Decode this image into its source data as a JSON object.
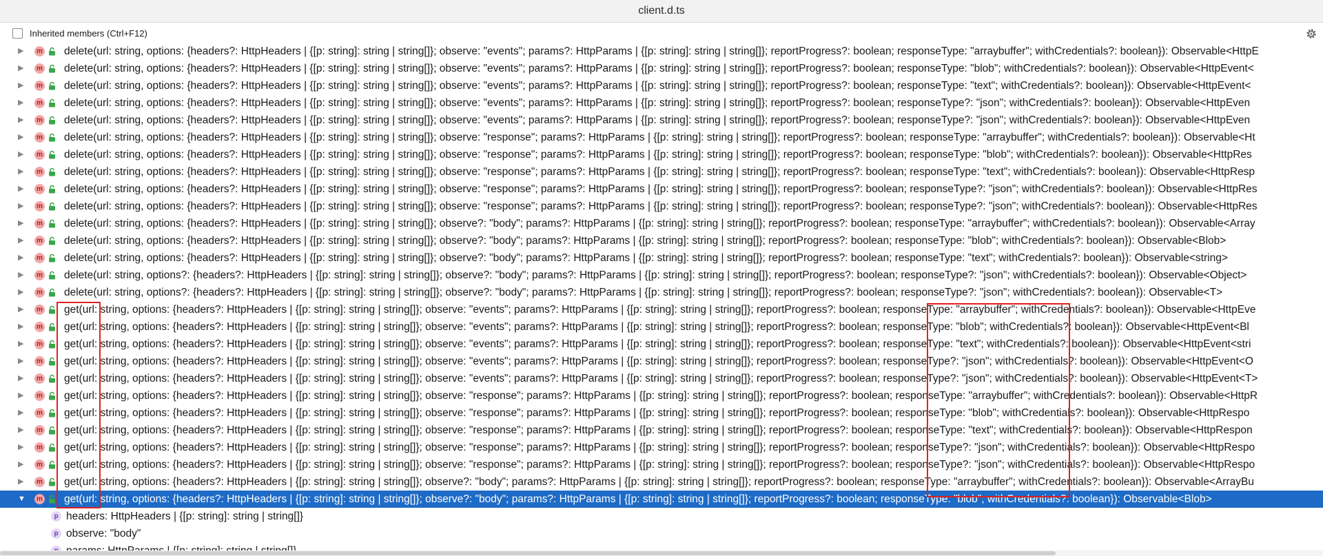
{
  "window": {
    "title": "client.d.ts"
  },
  "toolbar": {
    "inherited_label": "Inherited members (Ctrl+F12)",
    "inherited_checked": false,
    "settings_icon": "gear-icon"
  },
  "colors": {
    "selection": "#1e6bc7",
    "method_icon": "#f2a6a6",
    "property_icon": "#e4d7f5",
    "highlight_box": "#e02020"
  },
  "members": [
    {
      "kind": "m",
      "text": "delete(url: string, options: {headers?: HttpHeaders | {[p: string]: string | string[]}; observe: \"events\"; params?: HttpParams | {[p: string]: string | string[]}; reportProgress?: boolean; responseType: \"arraybuffer\"; withCredentials?: boolean}): Observable<HttpE"
    },
    {
      "kind": "m",
      "text": "delete(url: string, options: {headers?: HttpHeaders | {[p: string]: string | string[]}; observe: \"events\"; params?: HttpParams | {[p: string]: string | string[]}; reportProgress?: boolean; responseType: \"blob\"; withCredentials?: boolean}): Observable<HttpEvent<"
    },
    {
      "kind": "m",
      "text": "delete(url: string, options: {headers?: HttpHeaders | {[p: string]: string | string[]}; observe: \"events\"; params?: HttpParams | {[p: string]: string | string[]}; reportProgress?: boolean; responseType: \"text\"; withCredentials?: boolean}): Observable<HttpEvent<"
    },
    {
      "kind": "m",
      "text": "delete(url: string, options: {headers?: HttpHeaders | {[p: string]: string | string[]}; observe: \"events\"; params?: HttpParams | {[p: string]: string | string[]}; reportProgress?: boolean; responseType?: \"json\"; withCredentials?: boolean}): Observable<HttpEven"
    },
    {
      "kind": "m",
      "text": "delete(url: string, options: {headers?: HttpHeaders | {[p: string]: string | string[]}; observe: \"events\"; params?: HttpParams | {[p: string]: string | string[]}; reportProgress?: boolean; responseType?: \"json\"; withCredentials?: boolean}): Observable<HttpEven"
    },
    {
      "kind": "m",
      "text": "delete(url: string, options: {headers?: HttpHeaders | {[p: string]: string | string[]}; observe: \"response\"; params?: HttpParams | {[p: string]: string | string[]}; reportProgress?: boolean; responseType: \"arraybuffer\"; withCredentials?: boolean}): Observable<Ht"
    },
    {
      "kind": "m",
      "text": "delete(url: string, options: {headers?: HttpHeaders | {[p: string]: string | string[]}; observe: \"response\"; params?: HttpParams | {[p: string]: string | string[]}; reportProgress?: boolean; responseType: \"blob\"; withCredentials?: boolean}): Observable<HttpRes"
    },
    {
      "kind": "m",
      "text": "delete(url: string, options: {headers?: HttpHeaders | {[p: string]: string | string[]}; observe: \"response\"; params?: HttpParams | {[p: string]: string | string[]}; reportProgress?: boolean; responseType: \"text\"; withCredentials?: boolean}): Observable<HttpResp"
    },
    {
      "kind": "m",
      "text": "delete(url: string, options: {headers?: HttpHeaders | {[p: string]: string | string[]}; observe: \"response\"; params?: HttpParams | {[p: string]: string | string[]}; reportProgress?: boolean; responseType?: \"json\"; withCredentials?: boolean}): Observable<HttpRes"
    },
    {
      "kind": "m",
      "text": "delete(url: string, options: {headers?: HttpHeaders | {[p: string]: string | string[]}; observe: \"response\"; params?: HttpParams | {[p: string]: string | string[]}; reportProgress?: boolean; responseType?: \"json\"; withCredentials?: boolean}): Observable<HttpRes"
    },
    {
      "kind": "m",
      "text": "delete(url: string, options: {headers?: HttpHeaders | {[p: string]: string | string[]}; observe?: \"body\"; params?: HttpParams | {[p: string]: string | string[]}; reportProgress?: boolean; responseType: \"arraybuffer\"; withCredentials?: boolean}): Observable<Array"
    },
    {
      "kind": "m",
      "text": "delete(url: string, options: {headers?: HttpHeaders | {[p: string]: string | string[]}; observe?: \"body\"; params?: HttpParams | {[p: string]: string | string[]}; reportProgress?: boolean; responseType: \"blob\"; withCredentials?: boolean}): Observable<Blob>"
    },
    {
      "kind": "m",
      "text": "delete(url: string, options: {headers?: HttpHeaders | {[p: string]: string | string[]}; observe?: \"body\"; params?: HttpParams | {[p: string]: string | string[]}; reportProgress?: boolean; responseType: \"text\"; withCredentials?: boolean}): Observable<string>"
    },
    {
      "kind": "m",
      "text": "delete(url: string, options?: {headers?: HttpHeaders | {[p: string]: string | string[]}; observe?: \"body\"; params?: HttpParams | {[p: string]: string | string[]}; reportProgress?: boolean; responseType?: \"json\"; withCredentials?: boolean}): Observable<Object>"
    },
    {
      "kind": "m",
      "text": "delete(url: string, options?: {headers?: HttpHeaders | {[p: string]: string | string[]}; observe?: \"body\"; params?: HttpParams | {[p: string]: string | string[]}; reportProgress?: boolean; responseType?: \"json\"; withCredentials?: boolean}): Observable<T>"
    },
    {
      "kind": "m",
      "text": "get(url: string, options: {headers?: HttpHeaders | {[p: string]: string | string[]}; observe: \"events\"; params?: HttpParams | {[p: string]: string | string[]}; reportProgress?: boolean; responseType: \"arraybuffer\"; withCredentials?: boolean}): Observable<HttpEve"
    },
    {
      "kind": "m",
      "text": "get(url: string, options: {headers?: HttpHeaders | {[p: string]: string | string[]}; observe: \"events\"; params?: HttpParams | {[p: string]: string | string[]}; reportProgress?: boolean; responseType: \"blob\"; withCredentials?: boolean}): Observable<HttpEvent<Bl"
    },
    {
      "kind": "m",
      "text": "get(url: string, options: {headers?: HttpHeaders | {[p: string]: string | string[]}; observe: \"events\"; params?: HttpParams | {[p: string]: string | string[]}; reportProgress?: boolean; responseType: \"text\"; withCredentials?: boolean}): Observable<HttpEvent<stri"
    },
    {
      "kind": "m",
      "text": "get(url: string, options: {headers?: HttpHeaders | {[p: string]: string | string[]}; observe: \"events\"; params?: HttpParams | {[p: string]: string | string[]}; reportProgress?: boolean; responseType?: \"json\"; withCredentials?: boolean}): Observable<HttpEvent<O"
    },
    {
      "kind": "m",
      "text": "get(url: string, options: {headers?: HttpHeaders | {[p: string]: string | string[]}; observe: \"events\"; params?: HttpParams | {[p: string]: string | string[]}; reportProgress?: boolean; responseType?: \"json\"; withCredentials?: boolean}): Observable<HttpEvent<T>"
    },
    {
      "kind": "m",
      "text": "get(url: string, options: {headers?: HttpHeaders | {[p: string]: string | string[]}; observe: \"response\"; params?: HttpParams | {[p: string]: string | string[]}; reportProgress?: boolean; responseType: \"arraybuffer\"; withCredentials?: boolean}): Observable<HttpR"
    },
    {
      "kind": "m",
      "text": "get(url: string, options: {headers?: HttpHeaders | {[p: string]: string | string[]}; observe: \"response\"; params?: HttpParams | {[p: string]: string | string[]}; reportProgress?: boolean; responseType: \"blob\"; withCredentials?: boolean}): Observable<HttpRespo"
    },
    {
      "kind": "m",
      "text": "get(url: string, options: {headers?: HttpHeaders | {[p: string]: string | string[]}; observe: \"response\"; params?: HttpParams | {[p: string]: string | string[]}; reportProgress?: boolean; responseType: \"text\"; withCredentials?: boolean}): Observable<HttpRespon"
    },
    {
      "kind": "m",
      "text": "get(url: string, options: {headers?: HttpHeaders | {[p: string]: string | string[]}; observe: \"response\"; params?: HttpParams | {[p: string]: string | string[]}; reportProgress?: boolean; responseType?: \"json\"; withCredentials?: boolean}): Observable<HttpRespo"
    },
    {
      "kind": "m",
      "text": "get(url: string, options: {headers?: HttpHeaders | {[p: string]: string | string[]}; observe: \"response\"; params?: HttpParams | {[p: string]: string | string[]}; reportProgress?: boolean; responseType?: \"json\"; withCredentials?: boolean}): Observable<HttpRespo"
    },
    {
      "kind": "m",
      "text": "get(url: string, options: {headers?: HttpHeaders | {[p: string]: string | string[]}; observe?: \"body\"; params?: HttpParams | {[p: string]: string | string[]}; reportProgress?: boolean; responseType: \"arraybuffer\"; withCredentials?: boolean}): Observable<ArrayBu"
    },
    {
      "kind": "m",
      "selected": true,
      "expanded": true,
      "text": "get(url: string, options: {headers?: HttpHeaders | {[p: string]: string | string[]}; observe?: \"body\"; params?: HttpParams | {[p: string]: string | string[]}; reportProgress?: boolean; responseType: \"blob\"; withCredentials?: boolean}): Observable<Blob>"
    }
  ],
  "children": [
    {
      "kind": "p",
      "text": "headers: HttpHeaders | {[p: string]: string | string[]}"
    },
    {
      "kind": "p",
      "text": "observe: \"body\""
    },
    {
      "kind": "p",
      "text": "params: HttpParams | {[p: string]: string | string[]}"
    }
  ]
}
